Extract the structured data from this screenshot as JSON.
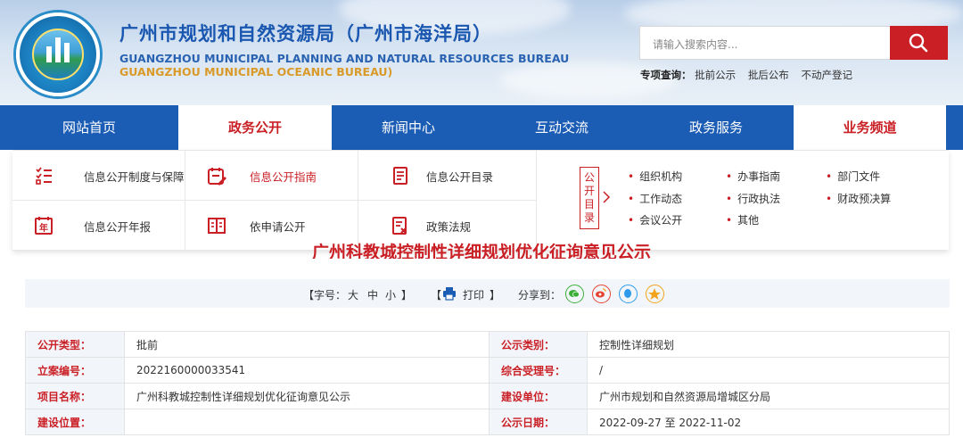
{
  "header": {
    "title_cn": "广州市规划和自然资源局（广州市海洋局）",
    "title_en_1": "GUANGZHOU MUNICIPAL PLANNING AND NATURAL RESOURCES BUREAU",
    "title_en_2": "GUANGZHOU MUNICIPAL OCEANIC BUREAU)",
    "search_placeholder": "请输入搜索内容...",
    "quick_label": "专项查询：",
    "quick_links": [
      "批前公示",
      "批后公布",
      "不动产登记"
    ]
  },
  "nav": [
    "网站首页",
    "政务公开",
    "新闻中心",
    "互动交流",
    "政务服务",
    "业务频道"
  ],
  "dropdown": {
    "items": [
      {
        "label": "信息公开制度与保障",
        "icon": "policy-list-icon"
      },
      {
        "label": "信息公开指南",
        "icon": "guide-icon"
      },
      {
        "label": "信息公开目录",
        "icon": "catalog-icon"
      },
      {
        "label": "信息公开年报",
        "icon": "annual-report-icon"
      },
      {
        "label": "依申请公开",
        "icon": "book-icon"
      },
      {
        "label": "政策法规",
        "icon": "regulation-icon"
      }
    ],
    "catalog_label": "公开目录",
    "catalog_links": [
      "组织机构",
      "工作动态",
      "会议公开",
      "办事指南",
      "行政执法",
      "其他",
      "部门文件",
      "财政预决算"
    ]
  },
  "article": {
    "title": "广州科教城控制性详细规划优化征询意见公示",
    "font_label": "【字号：",
    "font_big": "大",
    "font_mid": "中",
    "font_small": "小",
    "font_close": "】",
    "print_open": "【",
    "print_label": "打印",
    "print_close": "】",
    "share_label": "分享到："
  },
  "info": [
    {
      "k1": "公开类型：",
      "v1": "批前",
      "k2": "公示类别：",
      "v2": "控制性详细规划"
    },
    {
      "k1": "立案编号：",
      "v1": "2022160000033541",
      "k2": "综合受理号：",
      "v2": "/"
    },
    {
      "k1": "项目名称：",
      "v1": "广州科教城控制性详细规划优化征询意见公示",
      "k2": "建设单位：",
      "v2": "广州市规划和自然资源局增城区分局"
    },
    {
      "k1": "建设位置：",
      "v1": "",
      "k2": "公示日期：",
      "v2": "2022-09-27 至 2022-11-02"
    }
  ],
  "colors": {
    "brand_blue": "#1b5cb5",
    "accent_red": "#c91f25"
  }
}
